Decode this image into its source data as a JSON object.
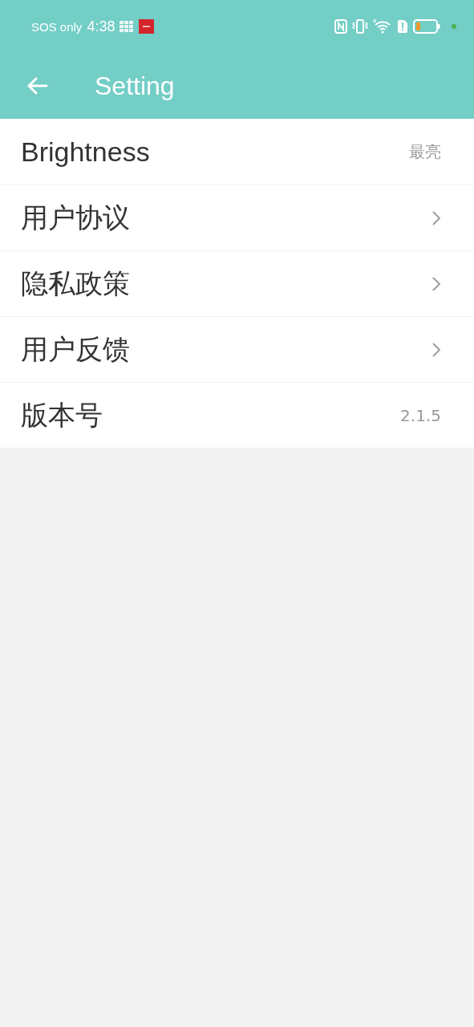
{
  "status_bar": {
    "carrier": "SOS only",
    "time": "4:38"
  },
  "header": {
    "title": "Setting"
  },
  "items": [
    {
      "label": "Brightness",
      "kind": "value",
      "value": "最亮"
    },
    {
      "label": "用户协议",
      "kind": "link"
    },
    {
      "label": "隐私政策",
      "kind": "link"
    },
    {
      "label": "用户反馈",
      "kind": "link"
    },
    {
      "label": "版本号",
      "kind": "value",
      "value": "2.1.5"
    }
  ]
}
